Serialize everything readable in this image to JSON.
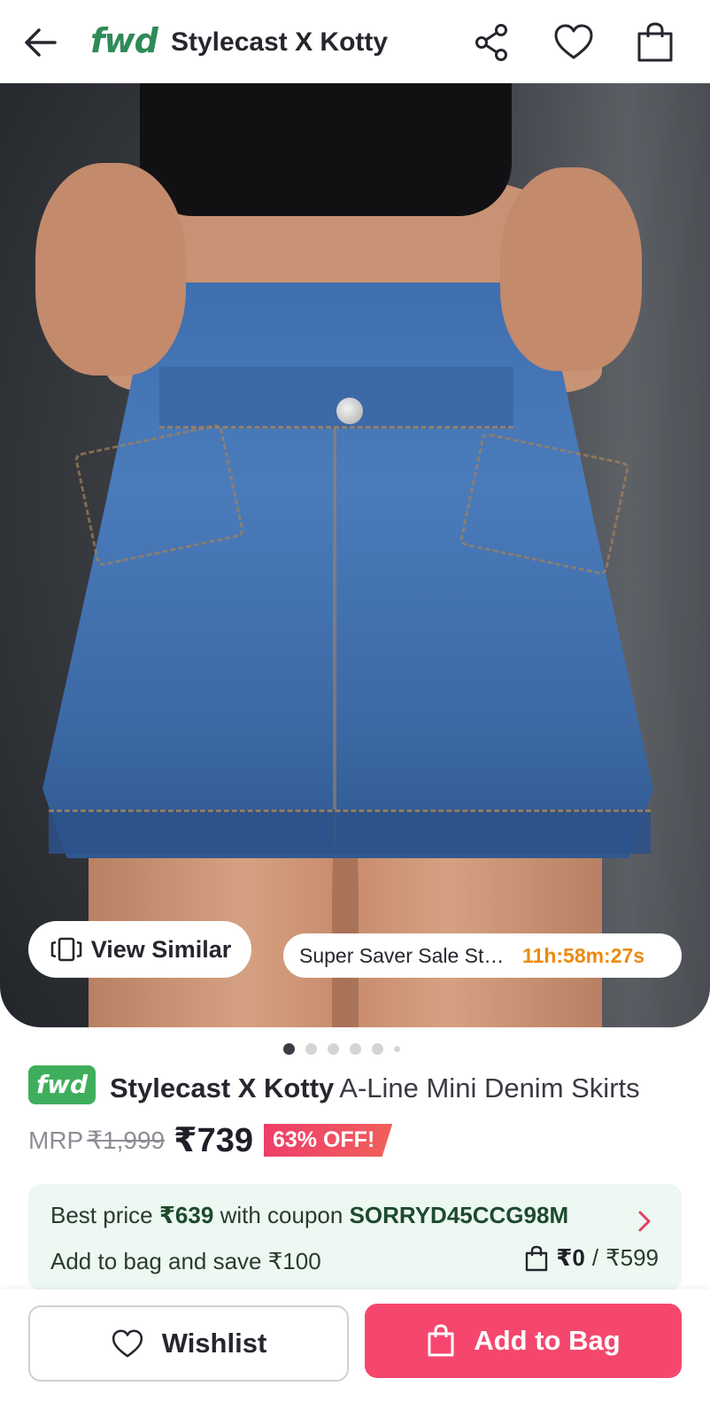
{
  "header": {
    "logo": "fwd",
    "title": "Stylecast X Kotty"
  },
  "overlay": {
    "view_similar": "View Similar",
    "sale_text": "Super Saver Sale Starts In",
    "sale_timer": "11h:58m:27s"
  },
  "carousel": {
    "total_dots": 6,
    "active_index": 0
  },
  "product": {
    "badge": "fwd",
    "brand": "Stylecast X Kotty",
    "name": "A-Line Mini Denim Skirts",
    "mrp_label": "MRP",
    "mrp_value": "₹1,999",
    "price": "₹739",
    "discount": "63% OFF!"
  },
  "coupon": {
    "prefix": "Best price",
    "best_price": "₹639",
    "middle": "with coupon",
    "code": "SORRYD45CCG98M",
    "save_text": "Add to bag and save ₹100",
    "bag_current": "₹0",
    "bag_separator": "/",
    "bag_target": "₹599"
  },
  "actions": {
    "wishlist": "Wishlist",
    "add_to_bag": "Add to Bag"
  },
  "colors": {
    "brand_green": "#2e8b57",
    "accent_pink": "#f5476e",
    "timer_orange": "#ee8a10",
    "coupon_bg": "#edf8f2"
  }
}
